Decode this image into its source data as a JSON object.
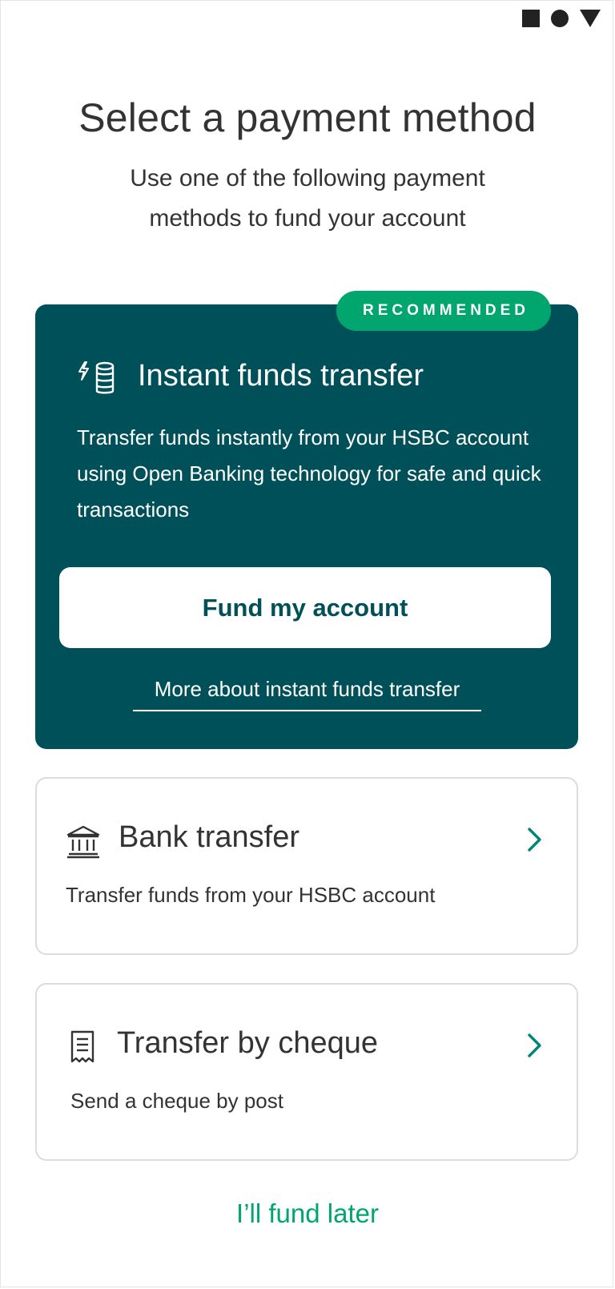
{
  "status_bar": {
    "icons": [
      "square-icon",
      "circle-icon",
      "triangle-icon"
    ]
  },
  "header": {
    "title": "Select a payment method",
    "subtitle": "Use one of the following payment methods to fund your account"
  },
  "recommended": {
    "badge": "RECOMMENDED",
    "icon": "instant-transfer-icon",
    "title": "Instant funds transfer",
    "description": "Transfer funds instantly from your HSBC account using Open Banking technology for safe and quick transactions",
    "button_label": "Fund my account",
    "link_label": "More about instant funds transfer"
  },
  "options": [
    {
      "icon": "bank-icon",
      "title": "Bank transfer",
      "description": "Transfer funds from your HSBC account"
    },
    {
      "icon": "cheque-icon",
      "title": "Transfer by cheque",
      "description": "Send a cheque by post"
    }
  ],
  "footer": {
    "later_label": "I’ll fund later"
  },
  "colors": {
    "card_teal": "#00505a",
    "accent_green": "#00a66e",
    "text_dark": "#333333",
    "border": "#dcdcdc"
  }
}
